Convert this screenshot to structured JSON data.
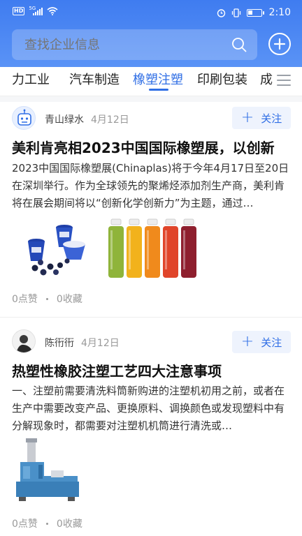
{
  "status_bar": {
    "network_badge": "HD",
    "signal_label": "5G",
    "time": "2:10",
    "battery_level": 0.35,
    "icons": [
      "signal-icon",
      "wifi-icon",
      "alarm-icon",
      "vibrate-icon",
      "battery-icon"
    ]
  },
  "search": {
    "placeholder": "查找企业信息",
    "icon": "search-icon",
    "add_icon": "plus-circle-icon"
  },
  "tabs": [
    {
      "label": "力工业",
      "active": false
    },
    {
      "label": "汽车制造",
      "active": false
    },
    {
      "label": "橡塑注塑",
      "active": true
    },
    {
      "label": "印刷包装",
      "active": false
    },
    {
      "label": "成",
      "active": false
    }
  ],
  "tab_menu_icon": "list-menu-icon",
  "colors": {
    "accent": "#2f6ee5",
    "header_top": "#3f7cf0",
    "header_bottom": "#5a93f6",
    "follow_bg": "#eef3fd"
  },
  "feed": [
    {
      "author": "青山绿水",
      "date": "4月12日",
      "follow_label": "关注",
      "follow_icon": "plus-icon",
      "title": "美利肯亮相2023中国国际橡塑展，以创新",
      "summary": "2023中国国际橡塑展(Chinaplas)将于今年4月17日至20日在深圳举行。作为全球领先的聚烯烃添加剂生产商，美利肯将在展会期间将以“创新化学创新力”为主题，通过…",
      "images": [
        "blueberry-yogurt-cups-image",
        "juice-bottles-image"
      ],
      "likes": "0点赞",
      "favorites": "0收藏"
    },
    {
      "author": "陈衎衎",
      "date": "4月12日",
      "follow_label": "关注",
      "follow_icon": "plus-icon",
      "title": "热塑性橡胶注塑工艺四大注意事项",
      "summary": "一、注塑前需要清洗料筒新购进的注塑机初用之前，或者在生产中需要改变产品、更换原料、调换颜色或发现塑料中有分解现象时，都需要对注塑机机筒进行清洗或…",
      "images": [
        "injection-molding-machine-image"
      ],
      "likes": "0点赞",
      "favorites": "0收藏"
    }
  ]
}
